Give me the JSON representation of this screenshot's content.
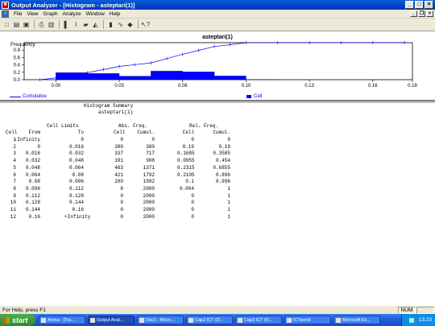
{
  "titlebar": {
    "title": "Output Analyzer - [Histogram - asteptari(1)]",
    "app_icon_glyph": "■",
    "buttons": {
      "minimize": "_",
      "maximize": "□",
      "close": "×"
    }
  },
  "menubar": {
    "mdi_icon_glyph": "▪",
    "items": [
      "File",
      "View",
      "Graph",
      "Analyze",
      "Window",
      "Help"
    ],
    "mdi_buttons": {
      "minimize": "_",
      "restore": "❐",
      "close": "×"
    }
  },
  "toolbar": {
    "icons": [
      "new-icon",
      "open-icon",
      "save-icon",
      "print-icon",
      "print-preview-icon",
      "bar-chart-icon",
      "line-chart-icon",
      "area-chart-icon",
      "line-graph-icon",
      "histogram-icon",
      "moving-average-icon",
      "point-icon",
      "help-pointer-icon"
    ],
    "glyphs": [
      "□",
      "▤",
      "▣",
      "⎙",
      "▥",
      "▌",
      "⌇",
      "▰",
      "◭",
      "▮",
      "∿",
      "◆",
      "↖?"
    ]
  },
  "chart": {
    "title": "asteptari(1)",
    "ylabel": "Frequency",
    "legend": {
      "cumulative": "Cumulative",
      "cell": "Cell"
    }
  },
  "chart_data": {
    "type": "bar",
    "title": "asteptari(1)",
    "ylabel": "Frequency",
    "xlim": [
      -0.016,
      0.18
    ],
    "ylim": [
      0,
      1.0
    ],
    "xticks": [
      "0.00",
      "0.03",
      "0.06",
      "0.10",
      "0.13",
      "0.16",
      "0.18"
    ],
    "xtick_values": [
      0.0,
      0.032,
      0.064,
      0.096,
      0.128,
      0.16,
      0.18
    ],
    "yticks": [
      "0.0",
      "0.2",
      "0.4",
      "0.6",
      "0.8"
    ],
    "ytick_values": [
      0.0,
      0.2,
      0.4,
      0.6,
      0.8
    ],
    "series": [
      {
        "name": "Cell",
        "kind": "bar",
        "color": "#0000ff",
        "bins": [
          [
            0,
            0.016
          ],
          [
            0.016,
            0.032
          ],
          [
            0.032,
            0.048
          ],
          [
            0.048,
            0.064
          ],
          [
            0.064,
            0.08
          ],
          [
            0.08,
            0.096
          ],
          [
            0.096,
            0.112
          ],
          [
            0.112,
            0.128
          ],
          [
            0.128,
            0.144
          ],
          [
            0.144,
            0.16
          ]
        ],
        "values": [
          0.19,
          0.1685,
          0.0955,
          0.2315,
          0.2105,
          0.1,
          0.004,
          0,
          0,
          0
        ]
      },
      {
        "name": "Cumulative",
        "kind": "line",
        "color": "#0000ff",
        "x": [
          -0.008,
          0.008,
          0.016,
          0.024,
          0.032,
          0.04,
          0.048,
          0.056,
          0.064,
          0.072,
          0.08,
          0.088,
          0.096,
          0.112,
          0.128,
          0.144,
          0.16,
          0.176
        ],
        "values": [
          0.0,
          0.095,
          0.19,
          0.274,
          0.359,
          0.406,
          0.454,
          0.57,
          0.686,
          0.791,
          0.896,
          0.946,
          0.996,
          1,
          1,
          1,
          1,
          1
        ]
      }
    ]
  },
  "report": {
    "title": "Histogram Summary",
    "subtitle": "asteptari(1)",
    "group_headers": {
      "limits": "Cell Limits",
      "abs": "Abs. Freq.",
      "rel": "Rel. Freq."
    },
    "columns": [
      "Cell",
      "From",
      "To",
      "Cell",
      "Cumul.",
      "Cell",
      "Cumul."
    ],
    "rows": [
      [
        "1",
        "-Infinity",
        "0",
        "0",
        "0",
        "0",
        "0"
      ],
      [
        "2",
        "0",
        "0.016",
        "380",
        "380",
        "0.19",
        "0.19"
      ],
      [
        "3",
        "0.016",
        "0.032",
        "337",
        "717",
        "0.1685",
        "0.3585"
      ],
      [
        "4",
        "0.032",
        "0.048",
        "191",
        "908",
        "0.0955",
        "0.454"
      ],
      [
        "5",
        "0.048",
        "0.064",
        "463",
        "1371",
        "0.2315",
        "0.6855"
      ],
      [
        "6",
        "0.064",
        "0.08",
        "421",
        "1792",
        "0.2105",
        "0.896"
      ],
      [
        "7",
        "0.08",
        "0.096",
        "200",
        "1992",
        "0.1",
        "0.996"
      ],
      [
        "8",
        "0.096",
        "0.112",
        "8",
        "2000",
        "0.004",
        "1"
      ],
      [
        "9",
        "0.112",
        "0.128",
        "0",
        "2000",
        "0",
        "1"
      ],
      [
        "10",
        "0.128",
        "0.144",
        "0",
        "2000",
        "0",
        "1"
      ],
      [
        "11",
        "0.144",
        "0.16",
        "0",
        "2000",
        "0",
        "1"
      ],
      [
        "12",
        "0.16",
        "+Infinity",
        "0",
        "2000",
        "0",
        "1"
      ]
    ]
  },
  "statusbar": {
    "message": "For Help, press F1",
    "num": "NUM"
  },
  "taskbar": {
    "start_label": "start",
    "tasks": [
      {
        "label": "Arena - [Tra...",
        "active": false
      },
      {
        "label": "Output Anal...",
        "active": true
      },
      {
        "label": "Doc1 - Micro...",
        "active": false
      },
      {
        "label": "Cap2 ICT (D...",
        "active": false
      },
      {
        "label": "Cap3 ICT (D...",
        "active": false
      },
      {
        "label": "ICTsemII",
        "active": false
      },
      {
        "label": "Microsoft Ex...",
        "active": false
      }
    ],
    "clock": "13:23"
  },
  "colors": {
    "series": "#0000ff",
    "titlebar": "#0a5fd8",
    "taskbar": "#245edb",
    "start": "#3c9a3c"
  }
}
